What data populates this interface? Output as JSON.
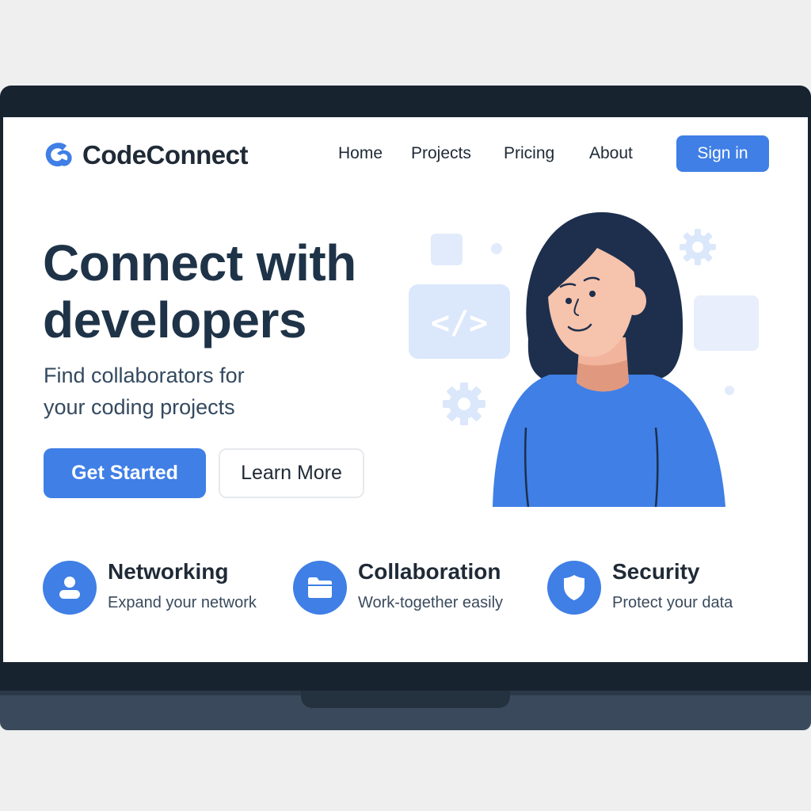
{
  "brand": {
    "name": "CodeConnect",
    "accent": "#3f7fe6"
  },
  "nav": {
    "items": [
      "Home",
      "Projects",
      "Pricing",
      "About"
    ],
    "signin_label": "Sign in"
  },
  "hero": {
    "title_line1": "Connect with",
    "title_line2": "developers",
    "subtitle_line1": "Find collaborators for",
    "subtitle_line2": "your coding projects",
    "primary_cta": "Get Started",
    "secondary_cta": "Learn More",
    "illustration_code_symbol": "</>"
  },
  "features": [
    {
      "icon": "user-icon",
      "title": "Networking",
      "desc": "Expand your network"
    },
    {
      "icon": "folder-icon",
      "title": "Collaboration",
      "desc": "Work-together easily"
    },
    {
      "icon": "shield-icon",
      "title": "Security",
      "desc": "Protect your data"
    }
  ]
}
